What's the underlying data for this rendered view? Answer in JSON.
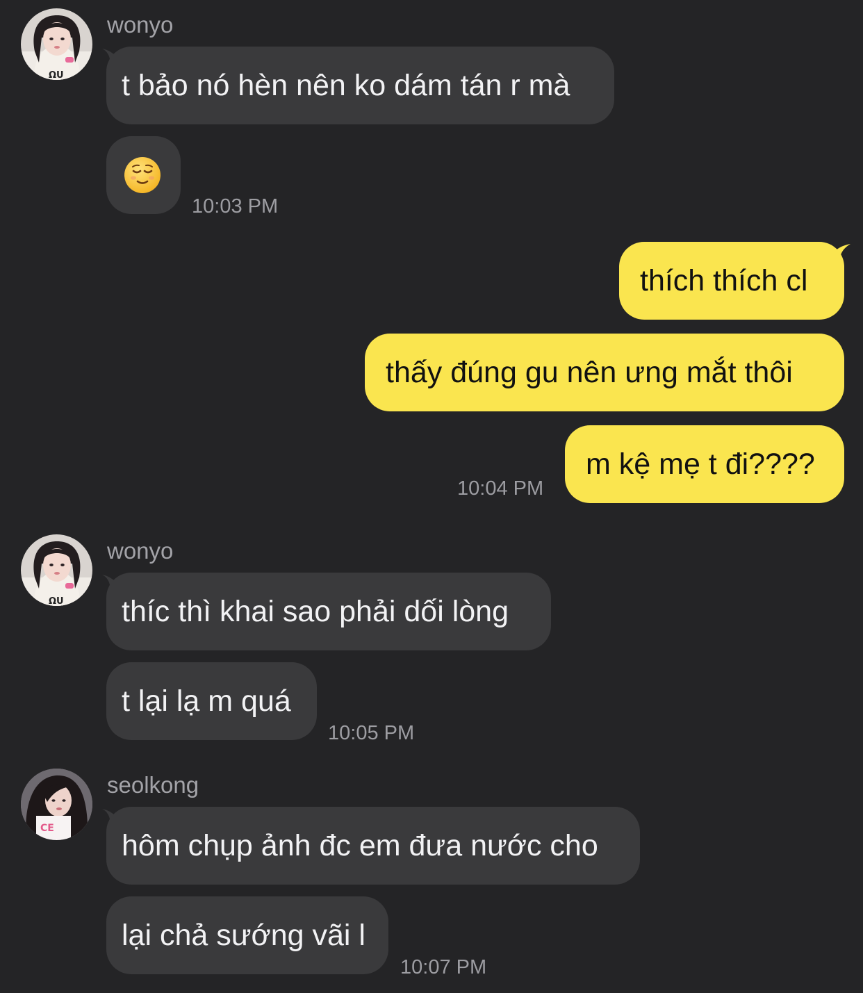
{
  "groups": [
    {
      "sender": "wonyo",
      "avatar": "avatar-photo",
      "messages": [
        "t bảo nó hèn nên ko dám tán r mà",
        "😌"
      ],
      "time": "10:03 PM"
    },
    {
      "sender": "me",
      "messages": [
        "thích thích cl",
        "thấy đúng gu nên ưng mắt thôi",
        "m kệ mẹ t đi????"
      ],
      "time": "10:04 PM"
    },
    {
      "sender": "wonyo",
      "avatar": "avatar-photo",
      "messages": [
        "thíc thì khai sao phải dối lòng",
        "t lại lạ m quá"
      ],
      "time": "10:05 PM"
    },
    {
      "sender": "seolkong",
      "avatar": "avatar-photo",
      "messages": [
        "hôm chụp ảnh đc em đưa nước cho",
        "lại chả sướng vãi l"
      ],
      "time": "10:07 PM"
    }
  ],
  "colors": {
    "background": "#242426",
    "incoming_bubble": "#3a3a3c",
    "outgoing_bubble": "#fae54f"
  },
  "icons": {
    "relieved_emoji": "relieved-face-emoji"
  }
}
